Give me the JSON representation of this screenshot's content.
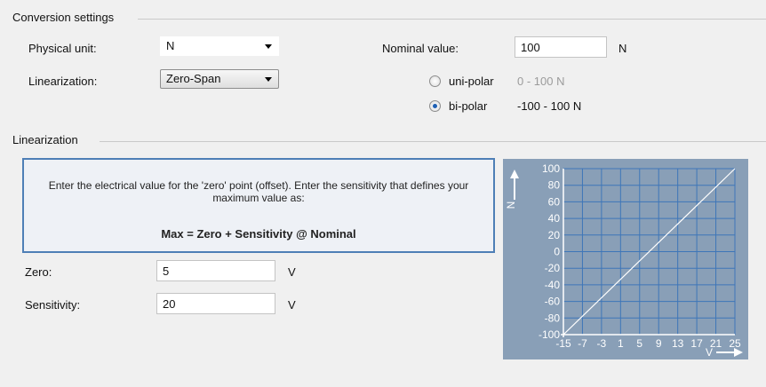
{
  "conversion": {
    "group_title": "Conversion settings",
    "physical_unit_label": "Physical unit:",
    "physical_unit_value": "N",
    "linearization_label": "Linearization:",
    "linearization_value": "Zero-Span",
    "nominal_label": "Nominal value:",
    "nominal_value": "100",
    "nominal_unit": "N",
    "unipolar_label": "uni-polar",
    "unipolar_range": "0 - 100 N",
    "bipolar_label": "bi-polar",
    "bipolar_range": "-100 - 100 N",
    "selected_polarity": "bi-polar"
  },
  "linearization": {
    "group_title": "Linearization",
    "info_text": "Enter the electrical value for the 'zero' point (offset). Enter the sensitivity that defines your maximum value as:",
    "formula": "Max = Zero + Sensitivity @ Nominal",
    "zero_label": "Zero:",
    "zero_value": "5",
    "zero_unit": "V",
    "sensitivity_label": "Sensitivity:",
    "sensitivity_value": "20",
    "sensitivity_unit": "V"
  },
  "chart_data": {
    "type": "line",
    "x_axis_label": "V",
    "y_axis_label": "N",
    "x_ticks": [
      "-15",
      "-7",
      "-3",
      "1",
      "5",
      "9",
      "13",
      "17",
      "21",
      "25"
    ],
    "y_ticks": [
      "100",
      "80",
      "60",
      "40",
      "20",
      "0",
      "-20",
      "-40",
      "-60",
      "-80",
      "-100"
    ],
    "xlim": [
      -15,
      25
    ],
    "ylim": [
      -100,
      100
    ],
    "grid": true,
    "series": [
      {
        "x": [
          -15,
          25
        ],
        "y": [
          -100,
          100
        ]
      }
    ],
    "colors": {
      "background": "#899fb7",
      "grid": "#3e76b8",
      "line": "#ffffff",
      "text": "#ffffff"
    }
  }
}
